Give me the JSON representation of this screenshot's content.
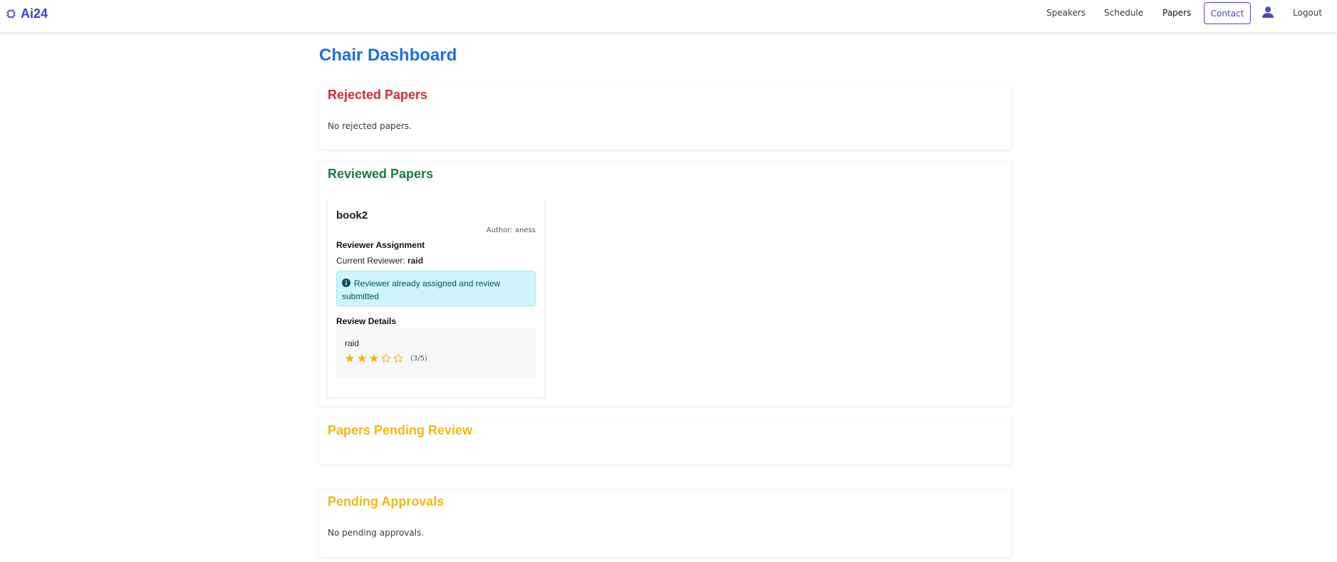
{
  "app": {
    "brand": "Ai24"
  },
  "nav": {
    "links": [
      "Speakers",
      "Schedule",
      "Papers"
    ],
    "contact": "Contact",
    "logout": "Logout"
  },
  "page": {
    "title": "Chair Dashboard"
  },
  "sections": {
    "rejected": {
      "title": "Rejected Papers",
      "empty_text": "No rejected papers."
    },
    "reviewed": {
      "title": "Reviewed Papers",
      "paper": {
        "title": "book2",
        "author": "Author: aness",
        "assignment_heading": "Reviewer Assignment",
        "current_reviewer_label": "Current Reviewer:",
        "current_reviewer": "raid",
        "info_message": "Reviewer already assigned and review submitted",
        "review_heading": "Review Details",
        "review": {
          "reviewer": "raid",
          "rating": 3,
          "max_rating": 5,
          "rating_text": "(3/5)"
        }
      }
    },
    "pending_review": {
      "title": "Papers Pending Review"
    },
    "pending_approvals": {
      "title": "Pending Approvals",
      "empty_text": "No pending approvals."
    }
  },
  "colors": {
    "brand": "#3b3ed6",
    "title": "#1d6fe0",
    "rejected": "#cf2b3a",
    "reviewed": "#1c7a46",
    "pending": "#f2b813",
    "star": "#f6b70f"
  }
}
